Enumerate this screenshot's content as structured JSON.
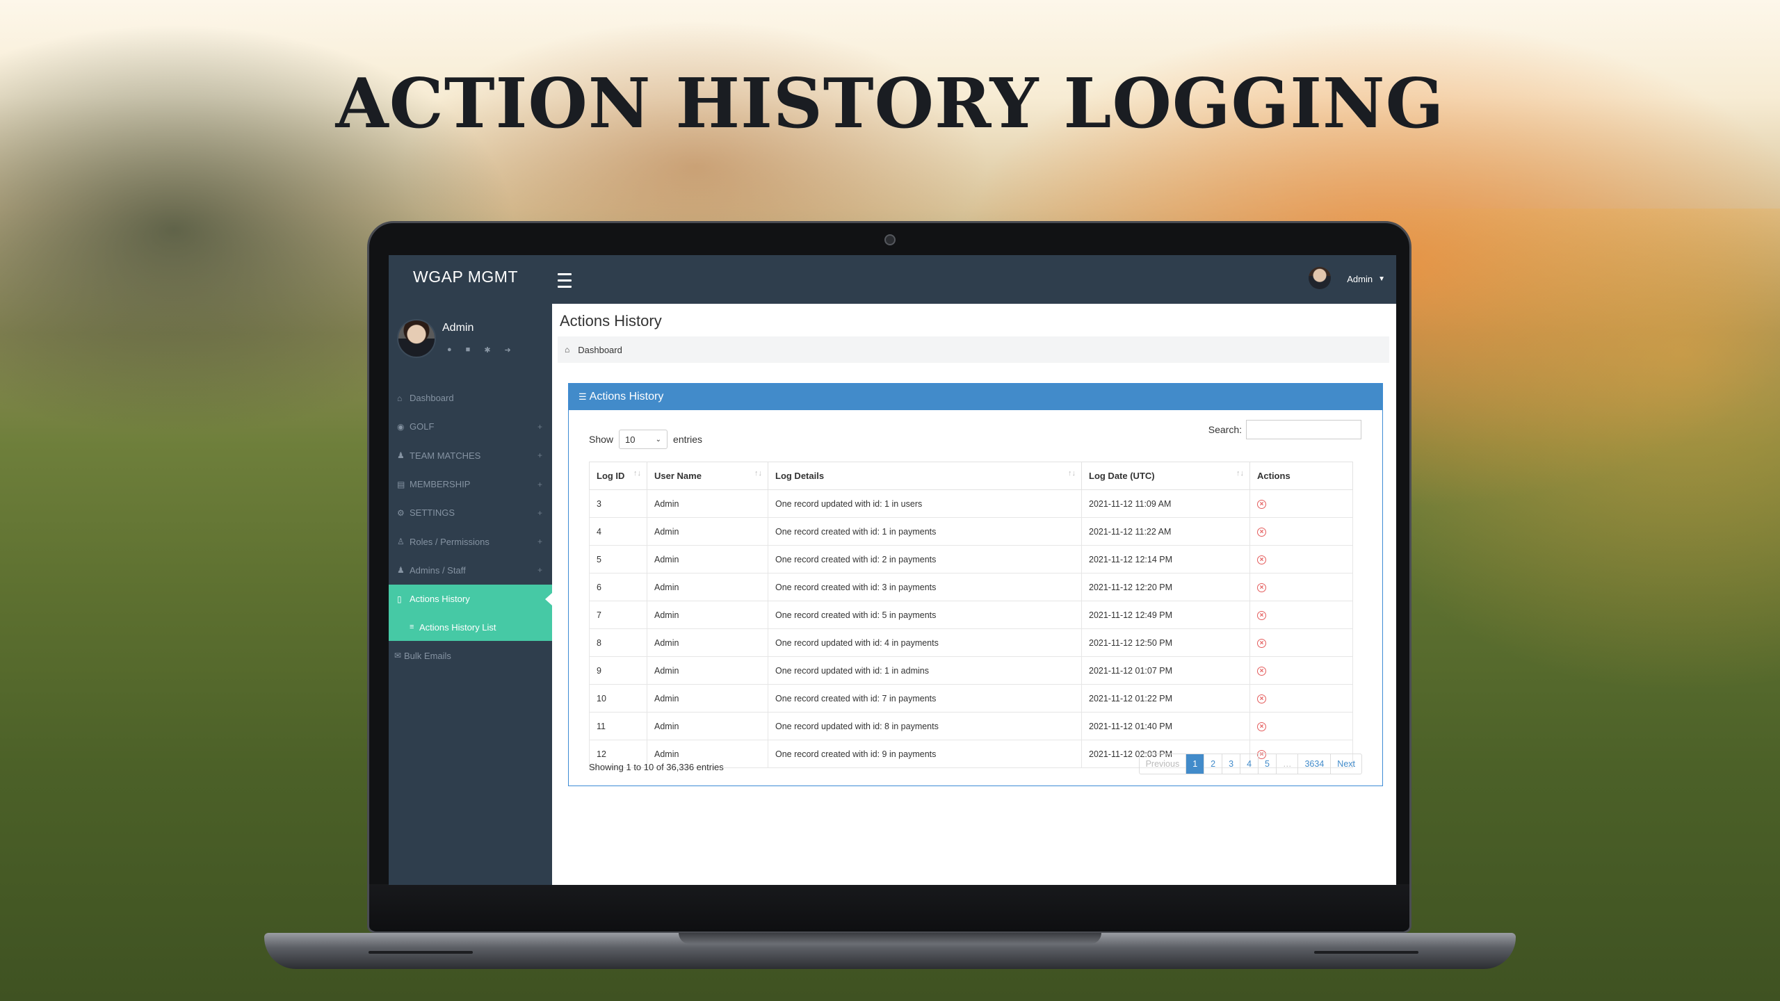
{
  "headline": "ACTION HISTORY LOGGING",
  "app": {
    "brand": "WGAP MGMT",
    "top_user": "Admin"
  },
  "sidebar": {
    "user_name": "Admin",
    "items": [
      {
        "label": "Dashboard",
        "icon": "home-icon",
        "expandable": false
      },
      {
        "label": "GOLF",
        "icon": "location-pin-icon",
        "expandable": true
      },
      {
        "label": "TEAM MATCHES",
        "icon": "users-icon",
        "expandable": true
      },
      {
        "label": "MEMBERSHIP",
        "icon": "card-icon",
        "expandable": true
      },
      {
        "label": "SETTINGS",
        "icon": "gear-icon",
        "expandable": true
      },
      {
        "label": "Roles / Permissions",
        "icon": "user-icon",
        "expandable": true
      },
      {
        "label": "Admins / Staff",
        "icon": "users-icon",
        "expandable": true
      },
      {
        "label": "Actions History",
        "icon": "book-icon",
        "expandable": false,
        "active": true
      }
    ],
    "sub_item": "Actions History List",
    "bulk_emails": "Bulk Emails"
  },
  "content": {
    "page_title": "Actions History",
    "breadcrumb": "Dashboard",
    "panel_title": "Actions History",
    "show_label": "Show",
    "entries_label": "entries",
    "page_size": "10",
    "search_label": "Search:",
    "search_value": "",
    "columns": [
      "Log ID",
      "User Name",
      "Log Details",
      "Log Date (UTC)",
      "Actions"
    ],
    "rows": [
      {
        "id": "3",
        "user": "Admin",
        "details": "One record updated with id: 1 in users",
        "date": "2021-11-12 11:09 AM"
      },
      {
        "id": "4",
        "user": "Admin",
        "details": "One record created with id: 1 in payments",
        "date": "2021-11-12 11:22 AM"
      },
      {
        "id": "5",
        "user": "Admin",
        "details": "One record created with id: 2 in payments",
        "date": "2021-11-12 12:14 PM"
      },
      {
        "id": "6",
        "user": "Admin",
        "details": "One record created with id: 3 in payments",
        "date": "2021-11-12 12:20 PM"
      },
      {
        "id": "7",
        "user": "Admin",
        "details": "One record created with id: 5 in payments",
        "date": "2021-11-12 12:49 PM"
      },
      {
        "id": "8",
        "user": "Admin",
        "details": "One record updated with id: 4 in payments",
        "date": "2021-11-12 12:50 PM"
      },
      {
        "id": "9",
        "user": "Admin",
        "details": "One record updated with id: 1 in admins",
        "date": "2021-11-12 01:07 PM"
      },
      {
        "id": "10",
        "user": "Admin",
        "details": "One record created with id: 7 in payments",
        "date": "2021-11-12 01:22 PM"
      },
      {
        "id": "11",
        "user": "Admin",
        "details": "One record updated with id: 8 in payments",
        "date": "2021-11-12 01:40 PM"
      },
      {
        "id": "12",
        "user": "Admin",
        "details": "One record created with id: 9 in payments",
        "date": "2021-11-12 02:03 PM"
      }
    ],
    "showing_text": "Showing 1 to 10 of 36,336 entries",
    "pagination": {
      "previous": "Previous",
      "pages": [
        "1",
        "2",
        "3",
        "4",
        "5",
        "…",
        "3634"
      ],
      "current": "1",
      "next": "Next"
    }
  },
  "colors": {
    "sidebar_bg": "#2f3e4d",
    "active_item": "#46c9a5",
    "panel_header": "#428bca",
    "delete_icon": "#e45c5c"
  }
}
